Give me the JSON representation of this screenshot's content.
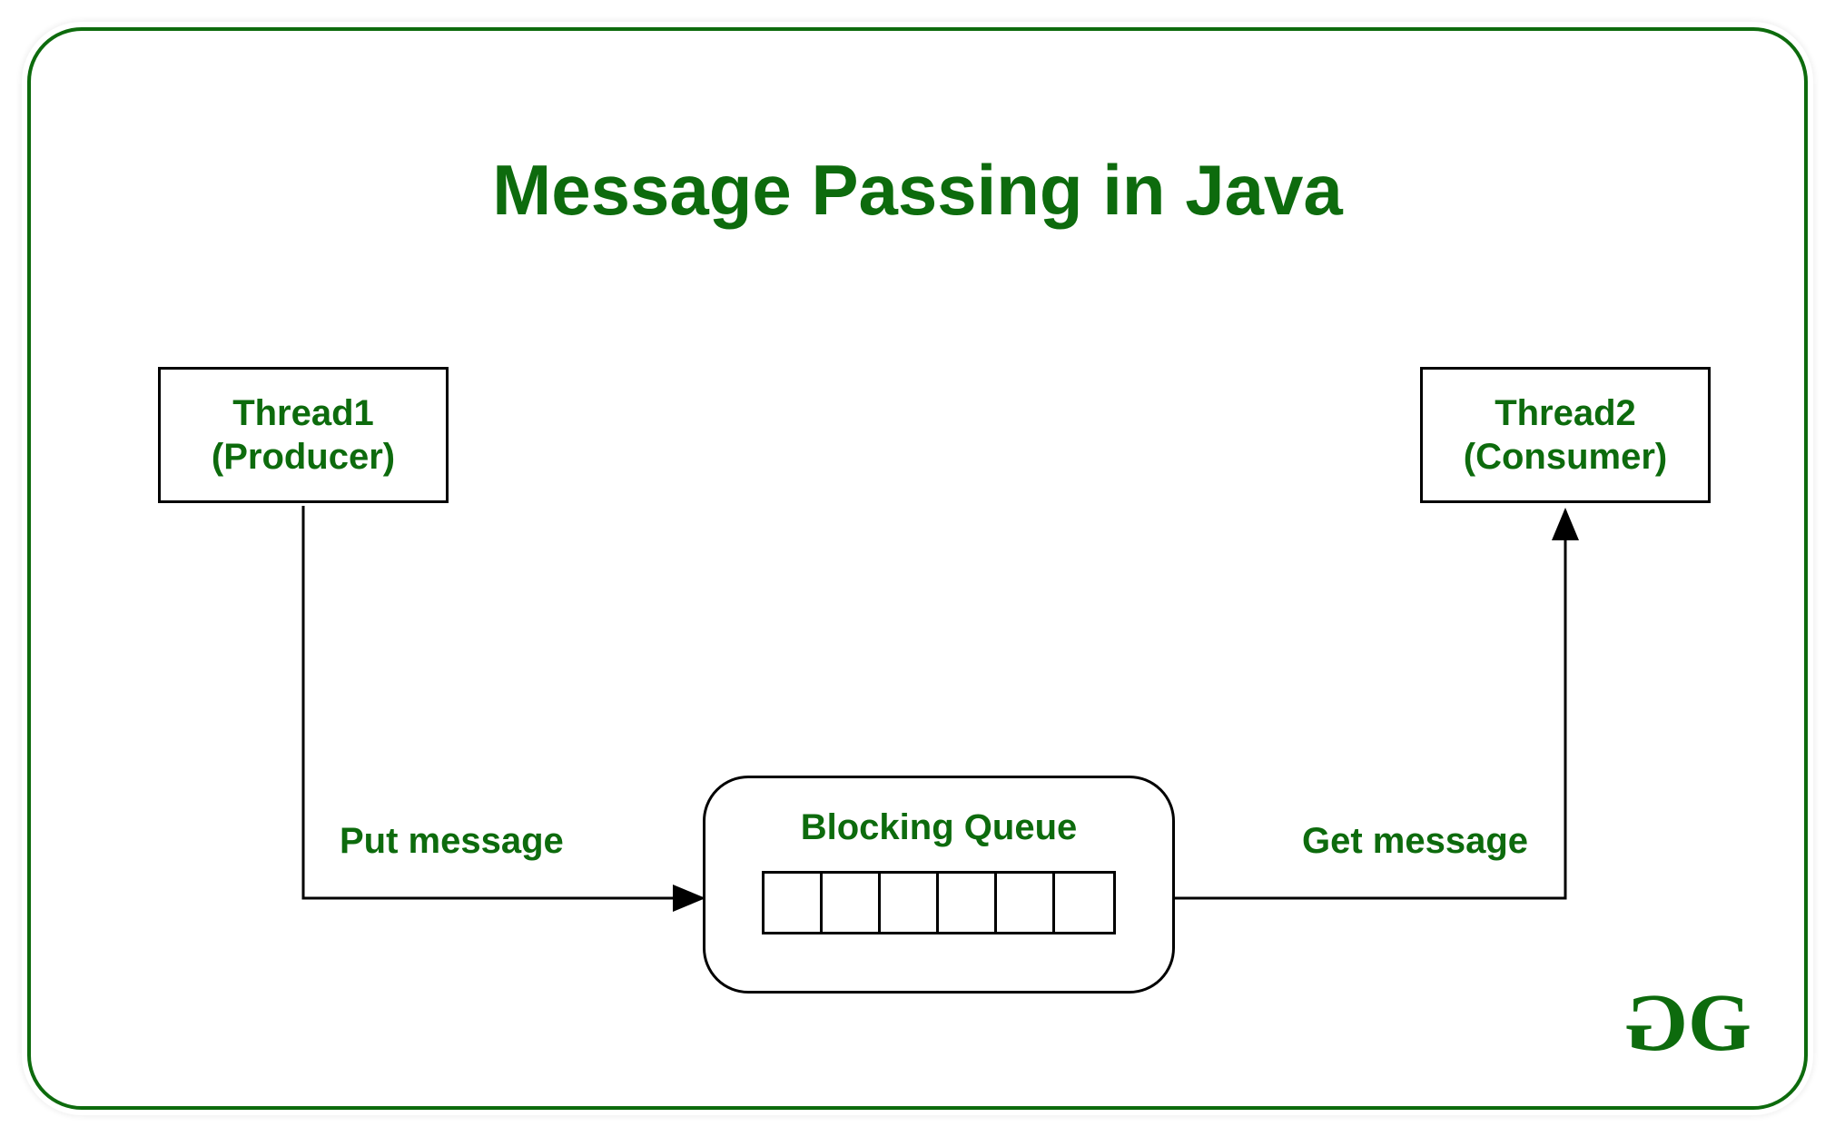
{
  "title": "Message Passing in Java",
  "thread1": {
    "line1": "Thread1",
    "line2": "(Producer)"
  },
  "thread2": {
    "line1": "Thread2",
    "line2": "(Consumer)"
  },
  "queue": {
    "title": "Blocking Queue",
    "cell_count": 6
  },
  "labels": {
    "put": "Put message",
    "get": "Get message"
  },
  "logo": {
    "char1": "G",
    "char2": "G"
  },
  "colors": {
    "accent": "#0d6b0d",
    "line": "#000000",
    "background": "#ffffff"
  }
}
